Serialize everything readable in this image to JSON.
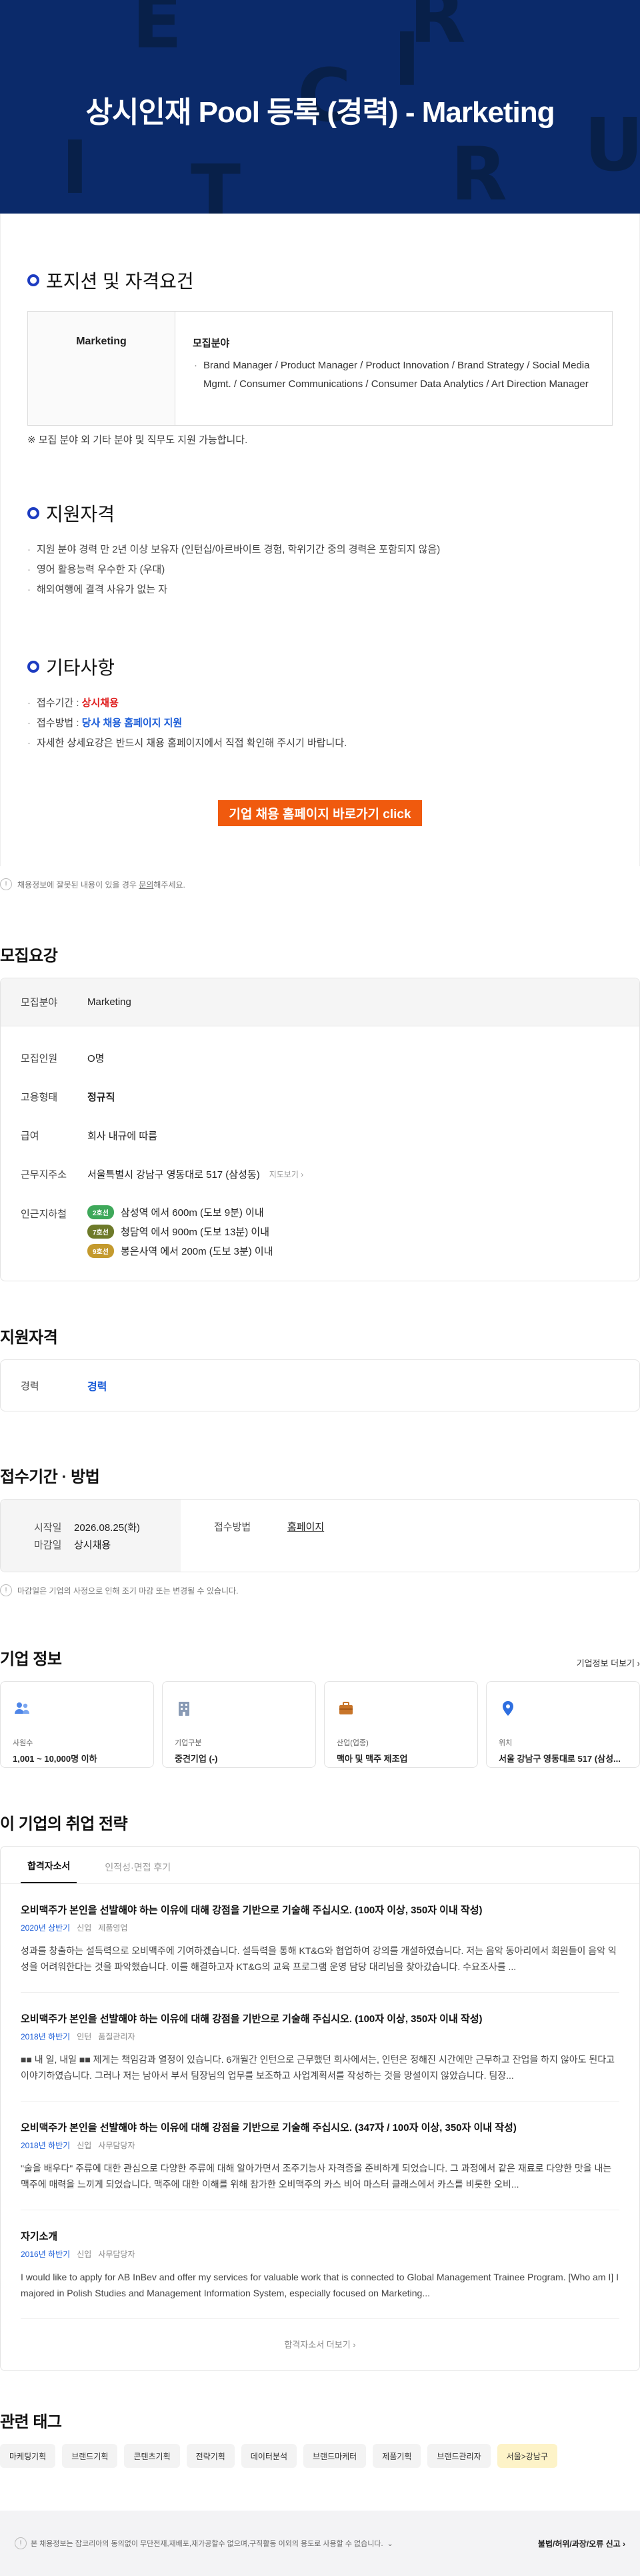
{
  "hero": {
    "title": "상시인재 Pool 등록 (경력) - Marketing",
    "deco_letters": [
      "E",
      "R",
      "C",
      "U",
      "I",
      "R",
      "I",
      "T"
    ]
  },
  "detail": {
    "position": {
      "heading": "포지션 및 자격요건",
      "field_name": "Marketing",
      "label": "모집분야",
      "value": "Brand Manager / Product Manager / Product Innovation / Brand Strategy / Social Media Mgmt. / Consumer Communications / Consumer Data Analytics / Art Direction Manager",
      "note": "※ 모집 분야 외 기타 분야 및 직무도 지원 가능합니다."
    },
    "qualification": {
      "heading": "지원자격",
      "items": [
        "지원 분야 경력 만 2년 이상 보유자 (인턴십/아르바이트 경험, 학위기간 중의 경력은 포함되지 않음)",
        "영어 활용능력 우수한 자 (우대)",
        "해외여행에 결격 사유가 없는 자"
      ]
    },
    "etc": {
      "heading": "기타사항",
      "period_label": "접수기간 : ",
      "period_value": "상시채용",
      "method_label": "접수방법 : ",
      "method_value": "당사 채용 홈페이지 지원",
      "note": "자세한 상세요강은 반드시 채용 홈페이지에서 직접 확인해 주시기 바랍니다."
    },
    "cta": "기업 채용 홈페이지 바로가기 click"
  },
  "report": {
    "pre": "채용정보에 잘못된 내용이 있을 경우 ",
    "link": "문의",
    "post": "해주세요."
  },
  "summary": {
    "title": "모집요강",
    "field_key": "모집분야",
    "field_val": "Marketing",
    "rows": [
      {
        "k": "모집인원",
        "v": "O명"
      },
      {
        "k": "고용형태",
        "v": "정규직"
      },
      {
        "k": "급여",
        "v": "회사 내규에 따름"
      }
    ],
    "addr_key": "근무지주소",
    "addr_val": "서울특별시 강남구 영동대로 517 (삼성동)",
    "map_link": "지도보기",
    "subway_key": "인근지하철",
    "subway": [
      {
        "badge": "2호선",
        "color": "#3ea85a",
        "text": "삼성역 에서 600m (도보 9분) 이내"
      },
      {
        "badge": "7호선",
        "color": "#6e7a2a",
        "text": "청담역 에서 900m (도보 13분) 이내"
      },
      {
        "badge": "9호선",
        "color": "#c49a2e",
        "text": "봉은사역 에서 200m (도보 3분) 이내"
      }
    ]
  },
  "qual2": {
    "title": "지원자격",
    "k": "경력",
    "v": "경력"
  },
  "apply": {
    "title": "접수기간 · 방법",
    "start_k": "시작일",
    "start_v": "2026.08.25(화)",
    "end_k": "마감일",
    "end_v": "상시채용",
    "method_k": "접수방법",
    "method_v": "홈페이지",
    "note": "마감일은 기업의 사정으로 인해 조기 마감 또는 변경될 수 있습니다."
  },
  "company": {
    "title": "기업 정보",
    "more": "기업정보 더보기",
    "cards": [
      {
        "k": "사원수",
        "v": "1,001 ~ 10,000명 이하",
        "icon": "people-icon",
        "color": "#4f86e8"
      },
      {
        "k": "기업구분",
        "v": "중견기업 (-)",
        "icon": "building-icon",
        "color": "#8a9bb5"
      },
      {
        "k": "산업(업종)",
        "v": "맥아 및 맥주 제조업",
        "icon": "briefcase-icon",
        "color": "#c8752a"
      },
      {
        "k": "위치",
        "v": "서울 강남구 영동대로 517 (삼성...",
        "icon": "location-pin-icon",
        "color": "#2f6fe0"
      }
    ]
  },
  "strategy": {
    "title": "이 기업의 취업 전략",
    "tabs": [
      "합격자소서",
      "인적성·면접 후기"
    ],
    "essays": [
      {
        "title": "오비맥주가 본인을 선발해야 하는 이유에 대해 강점을 기반으로 기술해 주십시오. (100자 이상, 350자 이내 작성)",
        "year": "2020년 상반기",
        "tags": [
          "신입",
          "제품영업"
        ],
        "body": "성과를 창출하는 설득력으로 오비맥주에 기여하겠습니다. 설득력을 통해 KT&G와 협업하여 강의를 개설하였습니다. 저는 음악 동아리에서 회원들이 음악 익성을 어려워한다는 것을 파악했습니다. 이를 해결하고자 KT&G의 교육 프로그램 운영 담당 대리님을 찾아갔습니다. 수요조사를 ..."
      },
      {
        "title": "오비맥주가 본인을 선발해야 하는 이유에 대해 강점을 기반으로 기술해 주십시오. (100자 이상, 350자 이내 작성)",
        "year": "2018년 하반기",
        "tags": [
          "인턴",
          "품질관리자"
        ],
        "body": "■■ 내 일, 내일 ■■ 제게는 책임감과 열정이 있습니다. 6개월간 인턴으로 근무했던 회사에서는, 인턴은 정해진 시간에만 근무하고 잔업을 하지 않아도 된다고 이야기하였습니다. 그러나 저는 남아서 부서 팀장님의 업무를 보조하고 사업계획서를 작성하는 것을 망설이지 않았습니다. 팀장..."
      },
      {
        "title": "오비맥주가 본인을 선발해야 하는 이유에 대해 강점을 기반으로 기술해 주십시오. (347자 / 100자 이상, 350자 이내 작성)",
        "year": "2018년 하반기",
        "tags": [
          "신입",
          "사무담당자"
        ],
        "body": "\"술을 배우다\" 주류에 대한 관심으로 다양한 주류에 대해 알아가면서 조주기능사 자격증을 준비하게 되었습니다. 그 과정에서 같은 재료로 다양한 맛을 내는 맥주에 매력을 느끼게 되었습니다. 맥주에 대한 이해를 위해 참가한 오비맥주의 카스 비어 마스터 클래스에서 카스를 비롯한 오비..."
      },
      {
        "title": "자기소개",
        "year": "2016년 하반기",
        "tags": [
          "신입",
          "사무담당자"
        ],
        "body": "I would like to apply for AB InBev and offer my services for valuable work that is connected to Global Management Trainee Program. [Who am I] I majored in Polish Studies and Management Information System, especially focused on Marketing..."
      }
    ],
    "more": "합격자소서 더보기"
  },
  "tags": {
    "title": "관련 태그",
    "items": [
      "마케팅기획",
      "브랜드기획",
      "콘텐츠기획",
      "전략기획",
      "데이터분석",
      "브랜드마케터",
      "제품기획",
      "브랜드관리자",
      "서울>강남구"
    ]
  },
  "footer": {
    "left": "본 채용정보는 잡코리아의 동의없이 무단전재,재배포,재가공할수 없으며,구직활동 이외의 용도로 사용할 수 없습니다.",
    "right": "불법/허위/과장/오류 신고"
  },
  "colors": {
    "hero_bg": "#0b2a6a",
    "accent_blue": "#1a5cd8",
    "cta_orange": "#f05a0e",
    "red": "#e02020"
  }
}
